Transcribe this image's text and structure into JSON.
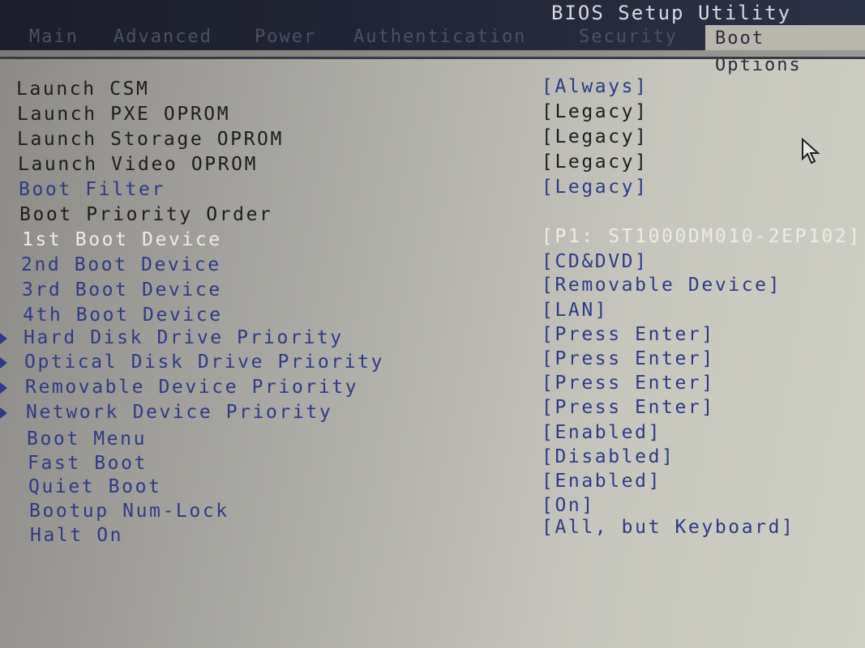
{
  "header": {
    "title": "BIOS Setup Utility",
    "tabs": [
      {
        "label": "Main",
        "active": false
      },
      {
        "label": "Advanced",
        "active": false
      },
      {
        "label": "Power",
        "active": false
      },
      {
        "label": "Authentication",
        "active": false
      },
      {
        "label": "Security",
        "active": false
      },
      {
        "label": "Boot Options",
        "active": true
      }
    ]
  },
  "settings": [
    {
      "label": "Launch CSM",
      "value": "[Always]"
    },
    {
      "label": "Launch PXE OPROM",
      "value": "[Legacy]"
    },
    {
      "label": "Launch Storage OPROM",
      "value": "[Legacy]"
    },
    {
      "label": "Launch Video OPROM",
      "value": "[Legacy]"
    },
    {
      "label": "Boot Filter",
      "value": "[Legacy]"
    },
    {
      "label": "Boot Priority Order",
      "value": ""
    },
    {
      "label": "1st Boot Device",
      "value": "[P1: ST1000DM010-2EP102]",
      "selected": true
    },
    {
      "label": "2nd Boot Device",
      "value": "[CD&DVD]"
    },
    {
      "label": "3rd Boot Device",
      "value": "[Removable Device]"
    },
    {
      "label": "4th Boot Device",
      "value": "[LAN]"
    },
    {
      "label": "Hard Disk Drive Priority",
      "value": "[Press Enter]",
      "submenu": true
    },
    {
      "label": "Optical Disk Drive Priority",
      "value": "[Press Enter]",
      "submenu": true
    },
    {
      "label": "Removable Device Priority",
      "value": "[Press Enter]",
      "submenu": true
    },
    {
      "label": "Network Device Priority",
      "value": "[Press Enter]",
      "submenu": true
    },
    {
      "label": "Boot Menu",
      "value": "[Enabled]"
    },
    {
      "label": "Fast Boot",
      "value": "[Disabled]"
    },
    {
      "label": "Quiet Boot",
      "value": "[Enabled]"
    },
    {
      "label": "Bootup Num-Lock",
      "value": "[On]"
    },
    {
      "label": "Halt On",
      "value": "[All, but Keyboard]"
    }
  ],
  "icons": {
    "cursor": "mouse-pointer-icon",
    "submenu": "triangle-right-icon"
  }
}
